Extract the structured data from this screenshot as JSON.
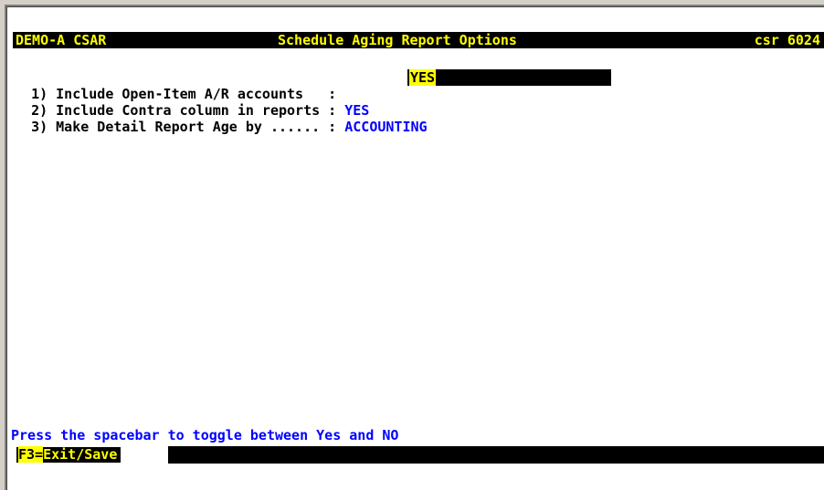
{
  "header": {
    "system": "DEMO-A CSAR",
    "title": "Schedule Aging Report Options",
    "screen_id": "csr 6024"
  },
  "options": [
    {
      "label": "1) Include Open-Item A/R accounts   : ",
      "value": "YES"
    },
    {
      "label": "2) Include Contra column in reports : ",
      "value": "YES"
    },
    {
      "label": "3) Make Detail Report Age by ...... : ",
      "value": "ACCOUNTING"
    }
  ],
  "hint": "Press the spacebar to toggle between Yes and NO",
  "function_keys": [
    {
      "key": "F3=",
      "label": "Exit/Save"
    }
  ],
  "colors": {
    "background": "#ffffff",
    "title_bar": "#000000",
    "title_text": "#ffff00",
    "value_text": "#0000ff",
    "active_field": "#ffff00"
  }
}
